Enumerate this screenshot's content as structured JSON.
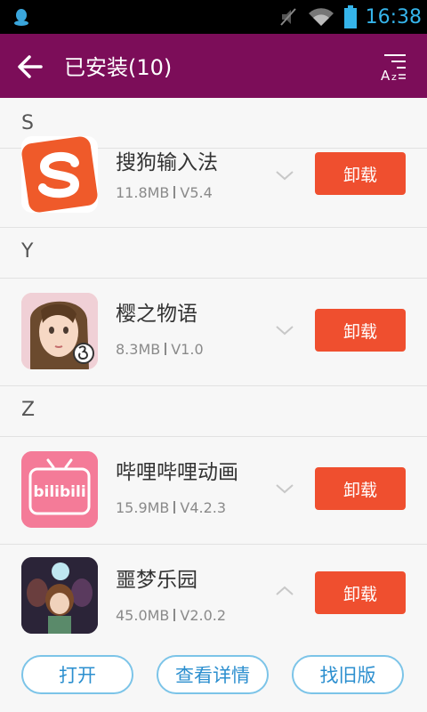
{
  "status_bar": {
    "time": "16:38",
    "icons": [
      "qq-icon",
      "mute-icon",
      "wifi-icon",
      "battery-icon"
    ]
  },
  "app_bar": {
    "title": "已安装(10)",
    "back_icon": "back-arrow-icon",
    "sort_icon": "sort-az-icon"
  },
  "sections": [
    {
      "letter": "S"
    },
    {
      "letter": "Y"
    },
    {
      "letter": "Z"
    }
  ],
  "apps": [
    {
      "name": "搜狗输入法",
      "size": "11.8MB",
      "version": "V5.4",
      "action": "卸载",
      "expanded": false
    },
    {
      "name": "樱之物语",
      "size": "8.3MB",
      "version": "V1.0",
      "action": "卸载",
      "expanded": false
    },
    {
      "name": "哔哩哔哩动画",
      "size": "15.9MB",
      "version": "V4.2.3",
      "action": "卸载",
      "expanded": false,
      "icon_text": "bilibili"
    },
    {
      "name": "噩梦乐园",
      "size": "45.0MB",
      "version": "V2.0.2",
      "action": "卸载",
      "expanded": true
    }
  ],
  "expanded_actions": {
    "open": "打开",
    "details": "查看详情",
    "old_version": "找旧版"
  },
  "colors": {
    "app_bar": "#7c0d59",
    "uninstall_button": "#ef4f2f",
    "pill_border": "#7cc4e8",
    "pill_text": "#2c8fcf"
  }
}
